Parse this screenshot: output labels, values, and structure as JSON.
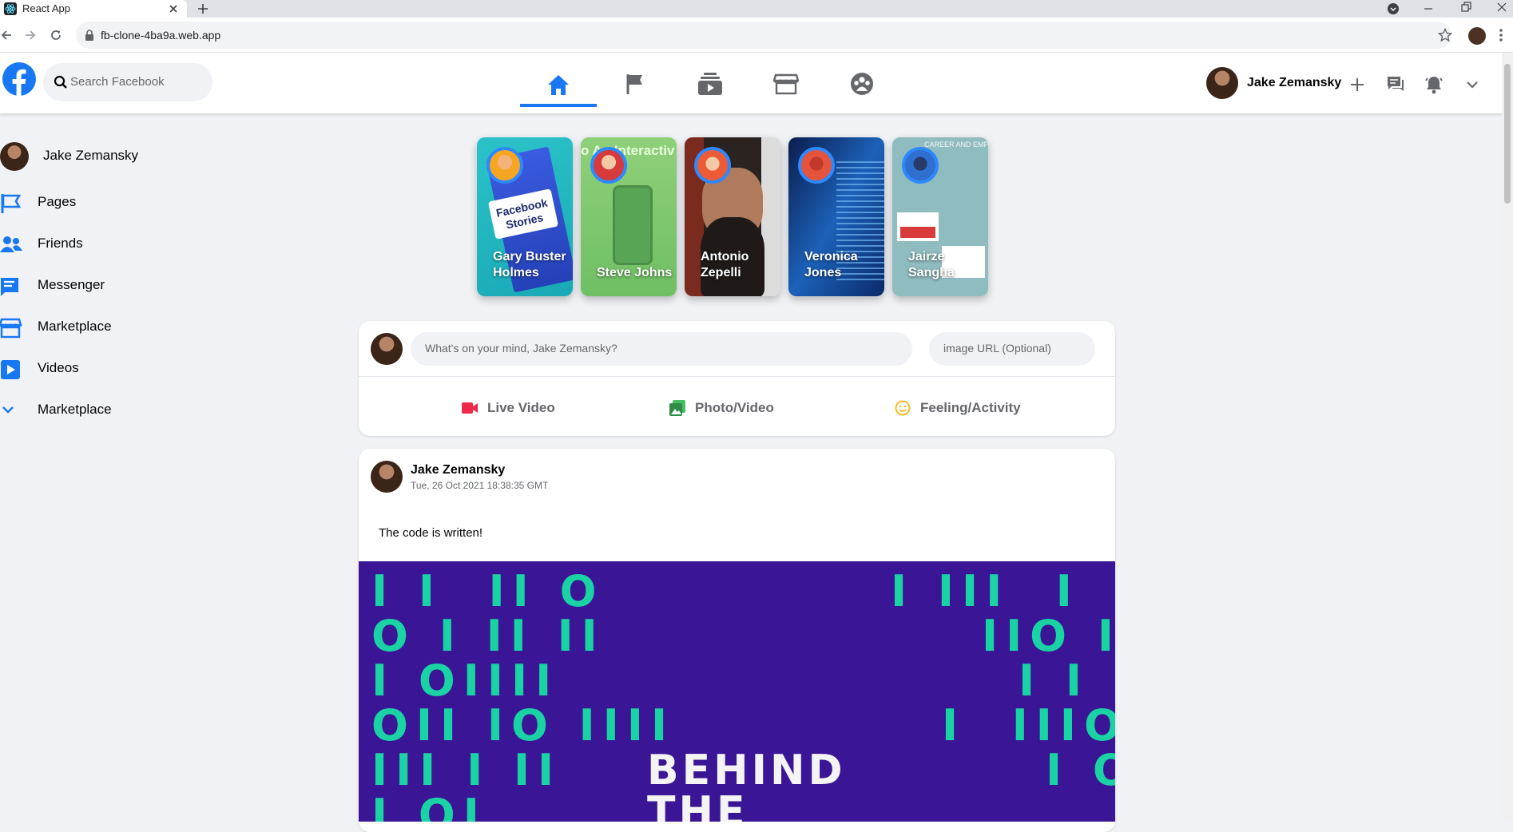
{
  "browser": {
    "tab_title": "React App",
    "url": "fb-clone-4ba9a.web.app"
  },
  "header": {
    "search_placeholder": "Search Facebook",
    "user_name": "Jake Zemansky",
    "nav_icons": [
      "home-icon",
      "flag-icon",
      "watch-icon",
      "marketplace-icon",
      "groups-icon"
    ],
    "accent": "#1877f2"
  },
  "sidebar": {
    "items": [
      {
        "label": "Jake Zemansky",
        "icon": "avatar"
      },
      {
        "label": "Pages",
        "icon": "flag-icon"
      },
      {
        "label": "Friends",
        "icon": "people-icon"
      },
      {
        "label": "Messenger",
        "icon": "chat-icon"
      },
      {
        "label": "Marketplace",
        "icon": "store-icon"
      },
      {
        "label": "Videos",
        "icon": "video-icon"
      },
      {
        "label": "Marketplace",
        "icon": "chevron-down-icon"
      }
    ]
  },
  "stories": [
    {
      "name": "Gary Buster Holmes",
      "card_text": "Facebook Stories"
    },
    {
      "name": "Steve Johns",
      "card_text": "o An Interactiv r gram Sto"
    },
    {
      "name": "Antonio Zepelli"
    },
    {
      "name": "Veronica Jones"
    },
    {
      "name": "Jairze Sangha",
      "card_text": "CAREER AND EMPLOYMENT"
    }
  ],
  "composer": {
    "message_placeholder": "What's on your mind, Jake Zemansky?",
    "image_placeholder": "image URL (Optional)",
    "actions": [
      "Live Video",
      "Photo/Video",
      "Feeling/Activity"
    ]
  },
  "post": {
    "author": "Jake Zemansky",
    "timestamp": "Tue, 26 Oct 2021 18:38:35 GMT",
    "message": "The code is written!",
    "image_text": "BEHIND THE"
  }
}
